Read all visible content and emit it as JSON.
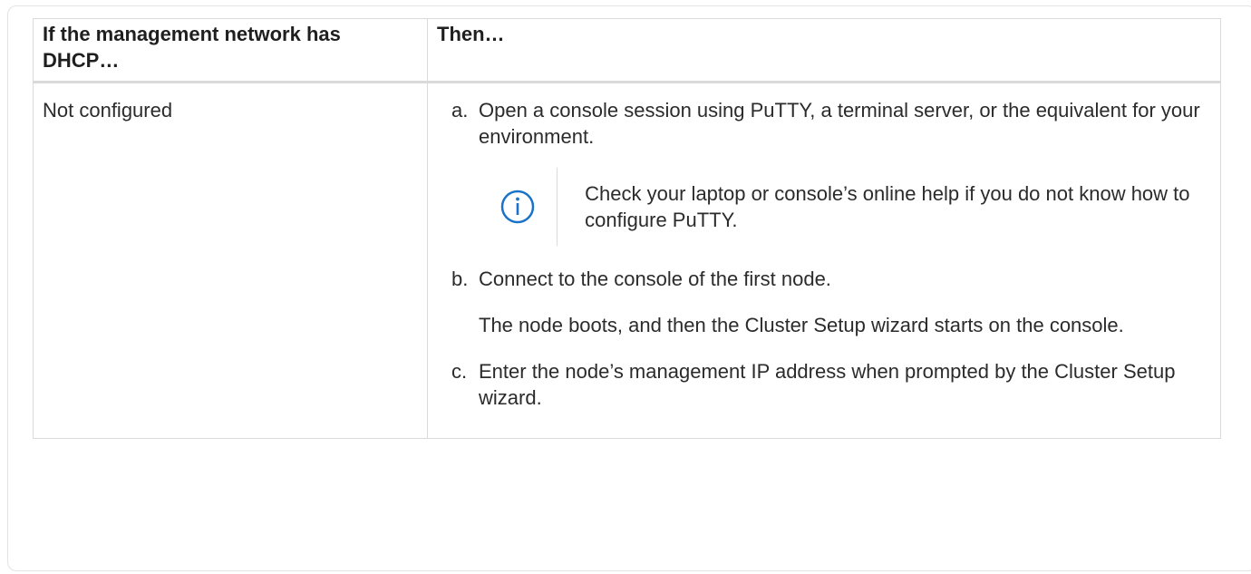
{
  "table": {
    "headers": [
      "If the management network has DHCP…",
      "Then…"
    ],
    "row": {
      "condition": "Not configured",
      "steps": [
        {
          "marker": "a.",
          "text": "Open a console session using PuTTY, a terminal server, or the equivalent for your environment.",
          "note": {
            "icon": "info-icon",
            "text": "Check your laptop or console’s online help if you do not know how to configure PuTTY."
          }
        },
        {
          "marker": "b.",
          "text": "Connect to the console of the first node.",
          "detail": "The node boots, and then the Cluster Setup wizard starts on the console."
        },
        {
          "marker": "c.",
          "text": "Enter the node’s management IP address when prompted by the Cluster Setup wizard."
        }
      ]
    }
  },
  "colors": {
    "info_icon": "#1a73c8",
    "border": "#dadada"
  }
}
